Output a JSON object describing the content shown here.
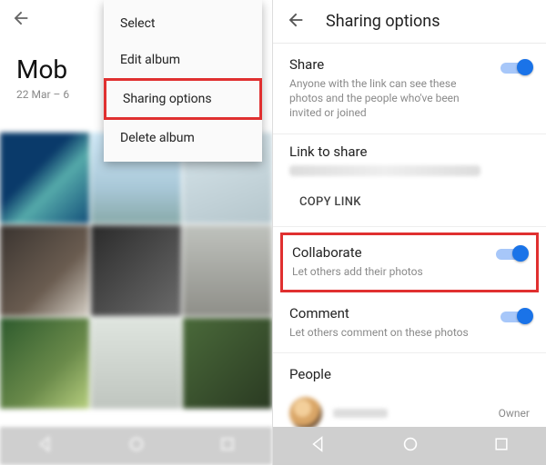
{
  "left": {
    "album_title": "Mob",
    "album_dates": "22 Mar – 6",
    "menu": {
      "select": "Select",
      "edit": "Edit album",
      "sharing": "Sharing options",
      "delete": "Delete album"
    }
  },
  "right": {
    "header_title": "Sharing options",
    "share": {
      "title": "Share",
      "desc": "Anyone with the link can see these photos and the people who've been invited or joined"
    },
    "link": {
      "title": "Link to share",
      "copy_label": "COPY LINK"
    },
    "collaborate": {
      "title": "Collaborate",
      "desc": "Let others add their photos"
    },
    "comment": {
      "title": "Comment",
      "desc": "Let others comment on these photos"
    },
    "people": {
      "title": "People",
      "owner_label": "Owner"
    }
  }
}
